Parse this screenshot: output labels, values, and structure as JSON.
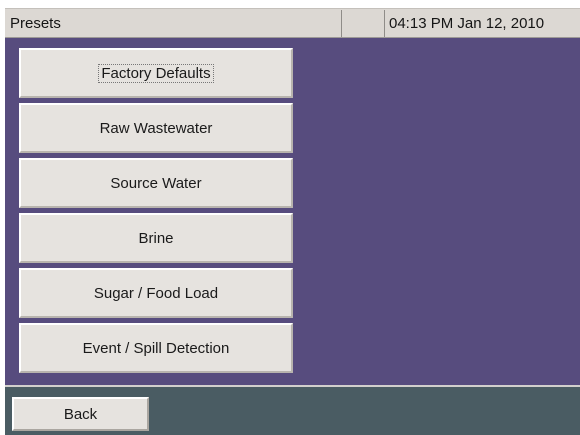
{
  "header": {
    "title": "Presets",
    "datetime": "04:13 PM Jan 12, 2010"
  },
  "presets": [
    {
      "label": "Factory Defaults"
    },
    {
      "label": "Raw Wastewater"
    },
    {
      "label": "Source Water"
    },
    {
      "label": "Brine"
    },
    {
      "label": "Sugar / Food Load"
    },
    {
      "label": "Event / Spill Detection"
    }
  ],
  "footer": {
    "back_label": "Back"
  },
  "colors": {
    "background": "#574c7e",
    "title_bar": "#dcd8d3",
    "button_face": "#e6e3df",
    "footer_bar": "#4a5c63"
  }
}
